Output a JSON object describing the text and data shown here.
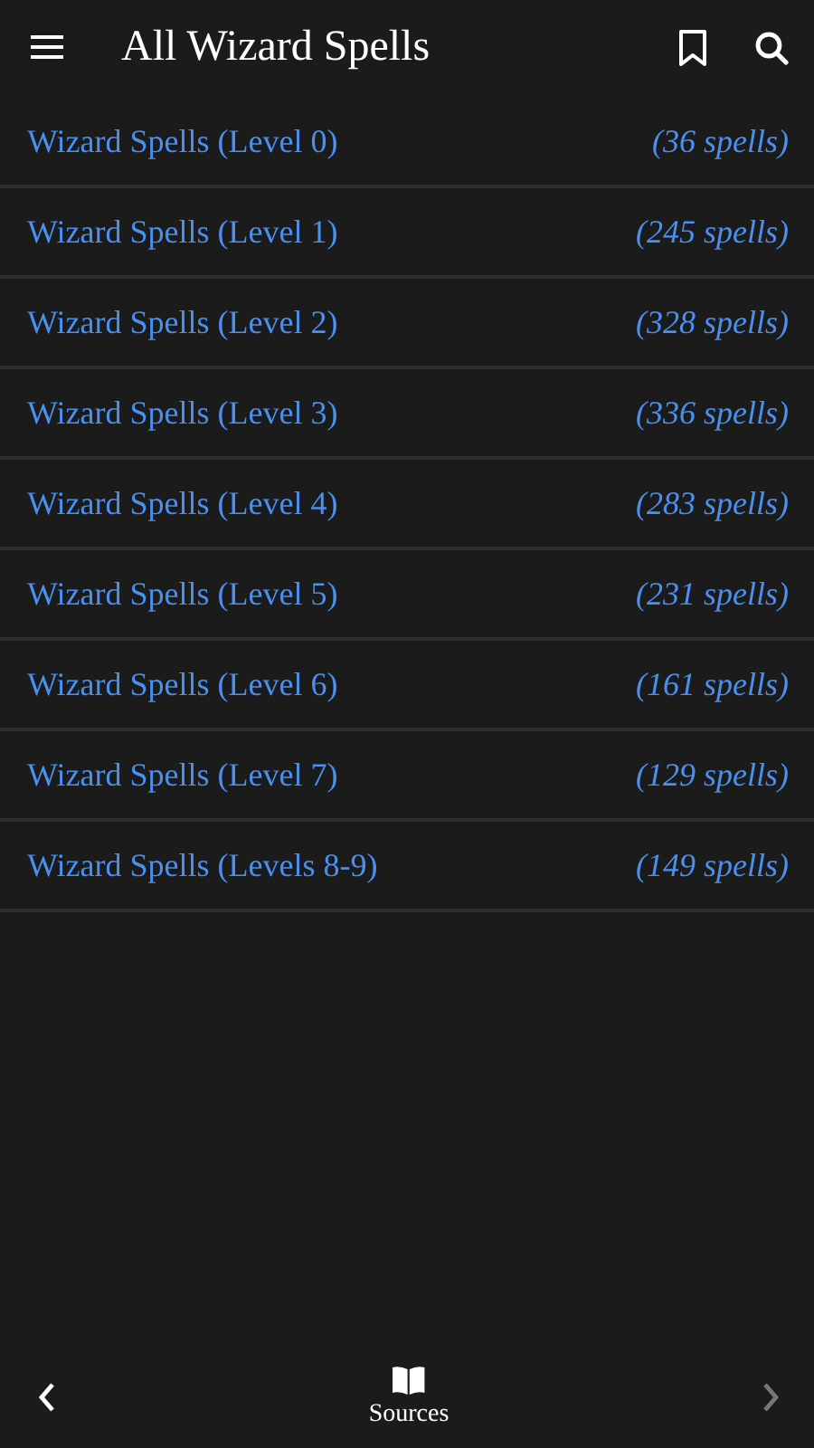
{
  "app_bar": {
    "title": "All Wizard Spells"
  },
  "spell_lists": [
    {
      "name": "Wizard Spells (Level 0)",
      "count": "(36 spells)"
    },
    {
      "name": "Wizard Spells (Level 1)",
      "count": "(245 spells)"
    },
    {
      "name": "Wizard Spells (Level 2)",
      "count": "(328 spells)"
    },
    {
      "name": "Wizard Spells (Level 3)",
      "count": "(336 spells)"
    },
    {
      "name": "Wizard Spells (Level 4)",
      "count": "(283 spells)"
    },
    {
      "name": "Wizard Spells (Level 5)",
      "count": "(231 spells)"
    },
    {
      "name": "Wizard Spells (Level 6)",
      "count": "(161 spells)"
    },
    {
      "name": "Wizard Spells (Level 7)",
      "count": "(129 spells)"
    },
    {
      "name": "Wizard Spells (Levels 8-9)",
      "count": "(149 spells)"
    }
  ],
  "bottom_bar": {
    "back": {
      "disabled": false
    },
    "center_label": "Sources",
    "forward": {
      "disabled": true
    }
  }
}
